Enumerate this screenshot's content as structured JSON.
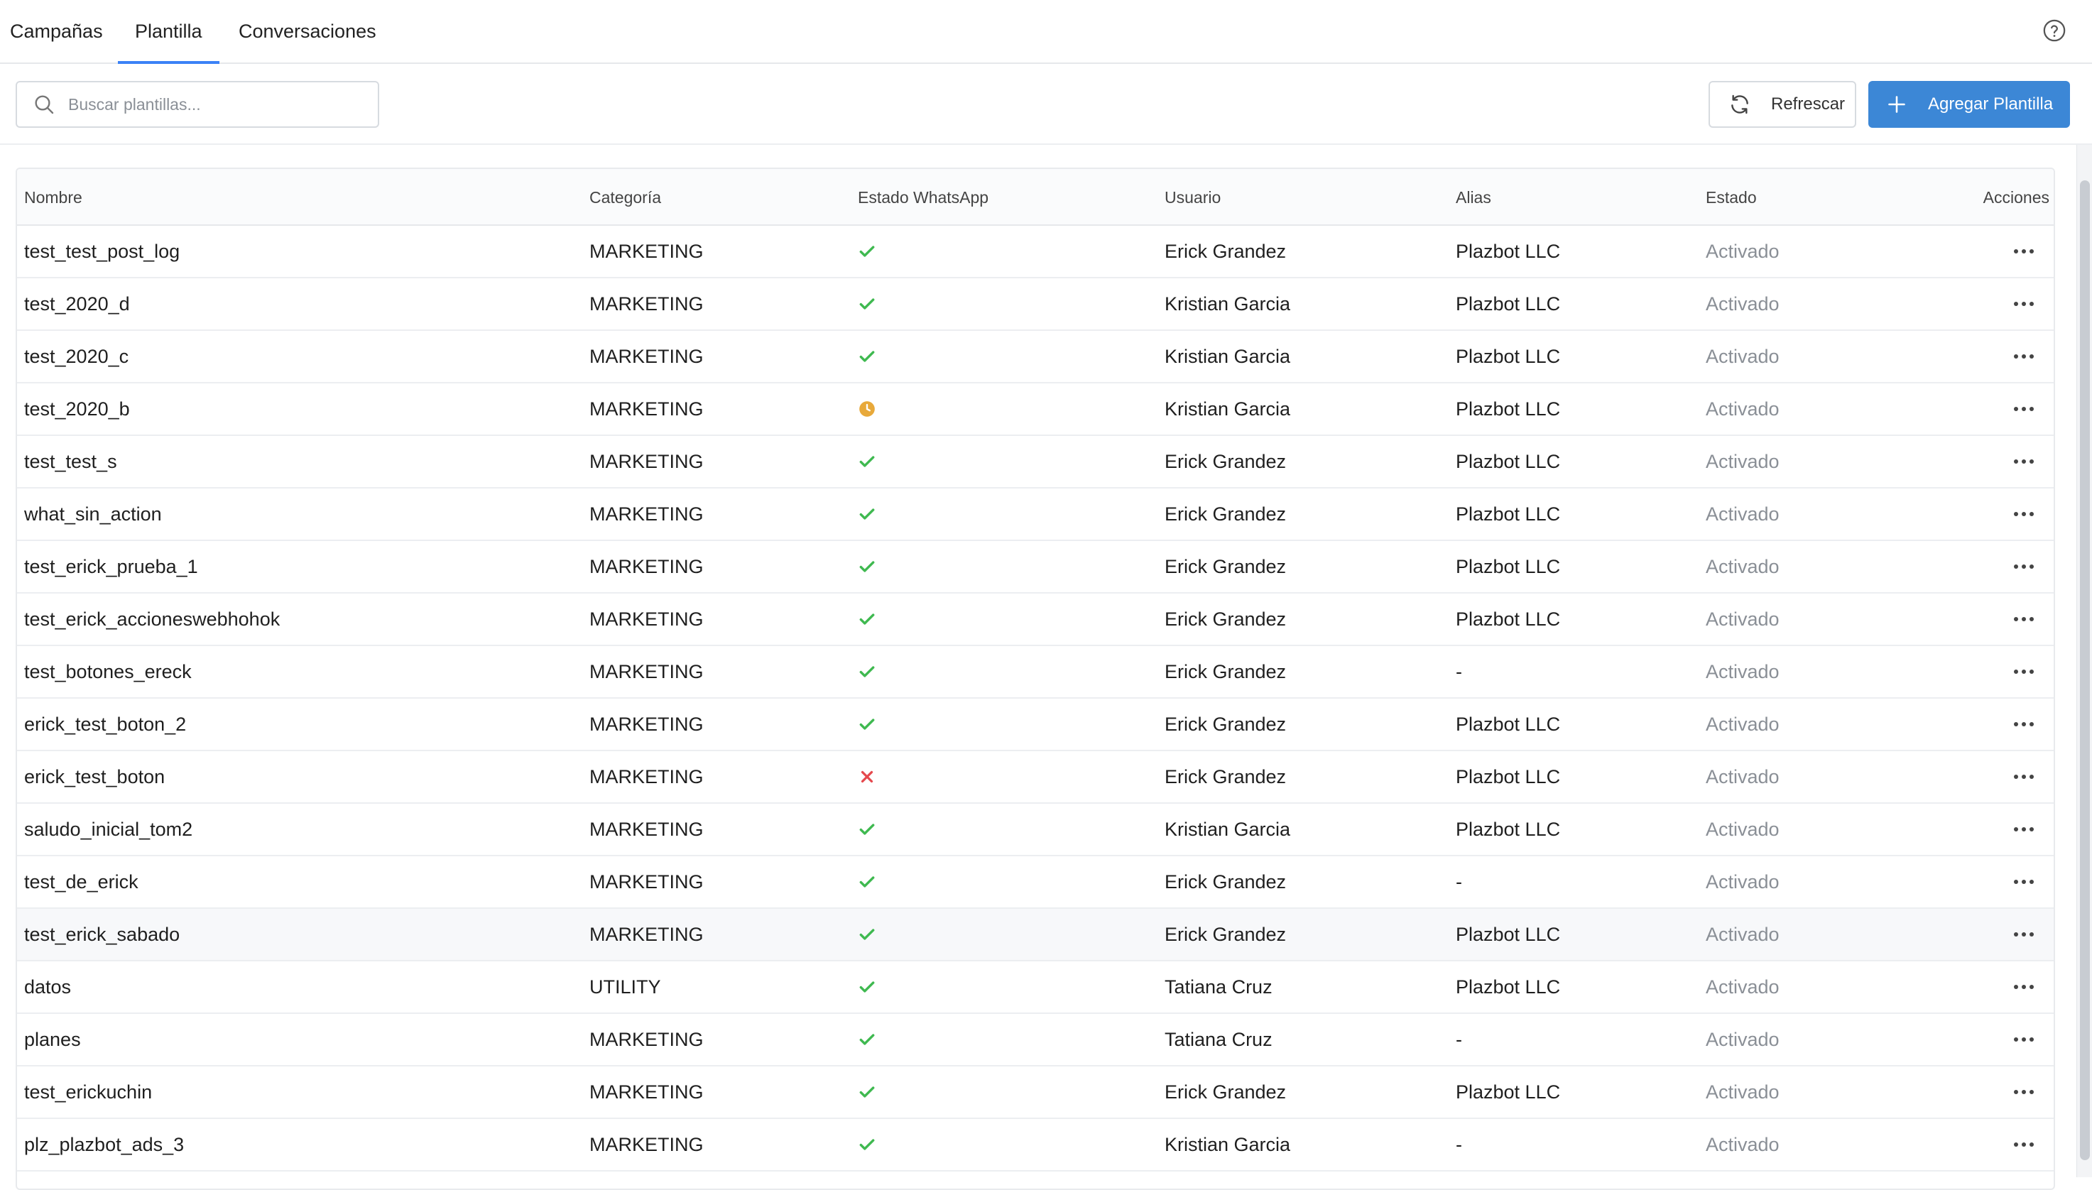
{
  "tabs": [
    {
      "label": "Campañas",
      "active": false
    },
    {
      "label": "Plantilla",
      "active": true
    },
    {
      "label": "Conversaciones",
      "active": false
    }
  ],
  "accent_color": "#3c87d6",
  "search": {
    "placeholder": "Buscar plantillas..."
  },
  "buttons": {
    "refresh_label": "Refrescar",
    "add_label": "Agregar Plantilla"
  },
  "table": {
    "headers": {
      "nombre": "Nombre",
      "categoria": "Categoría",
      "estado_whatsapp": "Estado WhatsApp",
      "usuario": "Usuario",
      "alias": "Alias",
      "estado": "Estado",
      "acciones": "Acciones"
    },
    "rows": [
      {
        "nombre": "test_test_post_log",
        "categoria": "MARKETING",
        "wa": "approved",
        "usuario": "Erick Grandez",
        "alias": "Plazbot LLC",
        "estado": "Activado"
      },
      {
        "nombre": "test_2020_d",
        "categoria": "MARKETING",
        "wa": "approved",
        "usuario": "Kristian Garcia",
        "alias": "Plazbot LLC",
        "estado": "Activado"
      },
      {
        "nombre": "test_2020_c",
        "categoria": "MARKETING",
        "wa": "approved",
        "usuario": "Kristian Garcia",
        "alias": "Plazbot LLC",
        "estado": "Activado"
      },
      {
        "nombre": "test_2020_b",
        "categoria": "MARKETING",
        "wa": "pending",
        "usuario": "Kristian Garcia",
        "alias": "Plazbot LLC",
        "estado": "Activado"
      },
      {
        "nombre": "test_test_s",
        "categoria": "MARKETING",
        "wa": "approved",
        "usuario": "Erick Grandez",
        "alias": "Plazbot LLC",
        "estado": "Activado"
      },
      {
        "nombre": "what_sin_action",
        "categoria": "MARKETING",
        "wa": "approved",
        "usuario": "Erick Grandez",
        "alias": "Plazbot LLC",
        "estado": "Activado"
      },
      {
        "nombre": "test_erick_prueba_1",
        "categoria": "MARKETING",
        "wa": "approved",
        "usuario": "Erick Grandez",
        "alias": "Plazbot LLC",
        "estado": "Activado"
      },
      {
        "nombre": "test_erick_accioneswebhohok",
        "categoria": "MARKETING",
        "wa": "approved",
        "usuario": "Erick Grandez",
        "alias": "Plazbot LLC",
        "estado": "Activado"
      },
      {
        "nombre": "test_botones_ereck",
        "categoria": "MARKETING",
        "wa": "approved",
        "usuario": "Erick Grandez",
        "alias": "-",
        "estado": "Activado"
      },
      {
        "nombre": "erick_test_boton_2",
        "categoria": "MARKETING",
        "wa": "approved",
        "usuario": "Erick Grandez",
        "alias": "Plazbot LLC",
        "estado": "Activado"
      },
      {
        "nombre": "erick_test_boton",
        "categoria": "MARKETING",
        "wa": "rejected",
        "usuario": "Erick Grandez",
        "alias": "Plazbot LLC",
        "estado": "Activado"
      },
      {
        "nombre": "saludo_inicial_tom2",
        "categoria": "MARKETING",
        "wa": "approved",
        "usuario": "Kristian Garcia",
        "alias": "Plazbot LLC",
        "estado": "Activado"
      },
      {
        "nombre": "test_de_erick",
        "categoria": "MARKETING",
        "wa": "approved",
        "usuario": "Erick Grandez",
        "alias": "-",
        "estado": "Activado"
      },
      {
        "nombre": "test_erick_sabado",
        "categoria": "MARKETING",
        "wa": "approved",
        "usuario": "Erick Grandez",
        "alias": "Plazbot LLC",
        "estado": "Activado",
        "highlighted": true
      },
      {
        "nombre": "datos",
        "categoria": "UTILITY",
        "wa": "approved",
        "usuario": "Tatiana Cruz",
        "alias": "Plazbot LLC",
        "estado": "Activado"
      },
      {
        "nombre": "planes",
        "categoria": "MARKETING",
        "wa": "approved",
        "usuario": "Tatiana Cruz",
        "alias": "-",
        "estado": "Activado"
      },
      {
        "nombre": "test_erickuchin",
        "categoria": "MARKETING",
        "wa": "approved",
        "usuario": "Erick Grandez",
        "alias": "Plazbot LLC",
        "estado": "Activado"
      },
      {
        "nombre": "plz_plazbot_ads_3",
        "categoria": "MARKETING",
        "wa": "approved",
        "usuario": "Kristian Garcia",
        "alias": "-",
        "estado": "Activado"
      }
    ]
  },
  "status_icons": {
    "approved": {
      "icon": "check-icon",
      "color": "#3fb950"
    },
    "pending": {
      "icon": "clock-icon",
      "color": "#e8a93a"
    },
    "rejected": {
      "icon": "x-icon",
      "color": "#e5484d"
    }
  }
}
